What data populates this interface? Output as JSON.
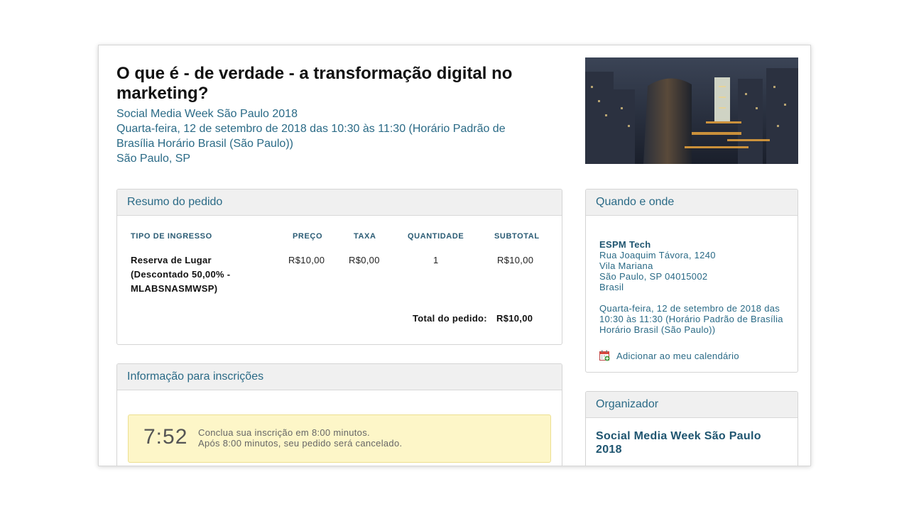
{
  "event": {
    "title": "O que é - de verdade - a transformação digital no marketing?",
    "series": "Social Media Week São Paulo 2018",
    "datetime": "Quarta-feira, 12 de setembro de 2018 das 10:30 às 11:30 (Horário Padrão de Brasília Horário Brasil (São Paulo))",
    "location": "São Paulo, SP"
  },
  "order_summary": {
    "heading": "Resumo do pedido",
    "columns": {
      "type": "TIPO DE INGRESSO",
      "price": "PREÇO",
      "fee": "TAXA",
      "quantity": "QUANTIDADE",
      "subtotal": "SUBTOTAL"
    },
    "rows": [
      {
        "type": "Reserva de Lugar (Descontado 50,00% - MLABSNASMWSP)",
        "price": "R$10,00",
        "fee": "R$0,00",
        "quantity": "1",
        "subtotal": "R$10,00"
      }
    ],
    "total_label": "Total do pedido:",
    "total_value": "R$10,00"
  },
  "registration": {
    "heading": "Informação para inscrições",
    "timer": "7:52",
    "timer_line1": "Conclua sua inscrição em 8:00 minutos.",
    "timer_line2": "Após 8:00 minutos, seu pedido será cancelado."
  },
  "when_where": {
    "heading": "Quando e onde",
    "venue_name": "ESPM Tech",
    "address1": "Rua Joaquim Távora, 1240",
    "address2": "Vila Mariana",
    "address3": "São Paulo, SP 04015002",
    "country": "Brasil",
    "datetime": "Quarta-feira, 12 de setembro de 2018 das 10:30 às 11:30 (Horário Padrão de Brasília Horário Brasil (São Paulo))",
    "calendar_link": "Adicionar ao meu calendário",
    "calendar_icon": "calendar-add-icon"
  },
  "organizer": {
    "heading": "Organizador",
    "name": "Social Media Week São Paulo 2018"
  }
}
